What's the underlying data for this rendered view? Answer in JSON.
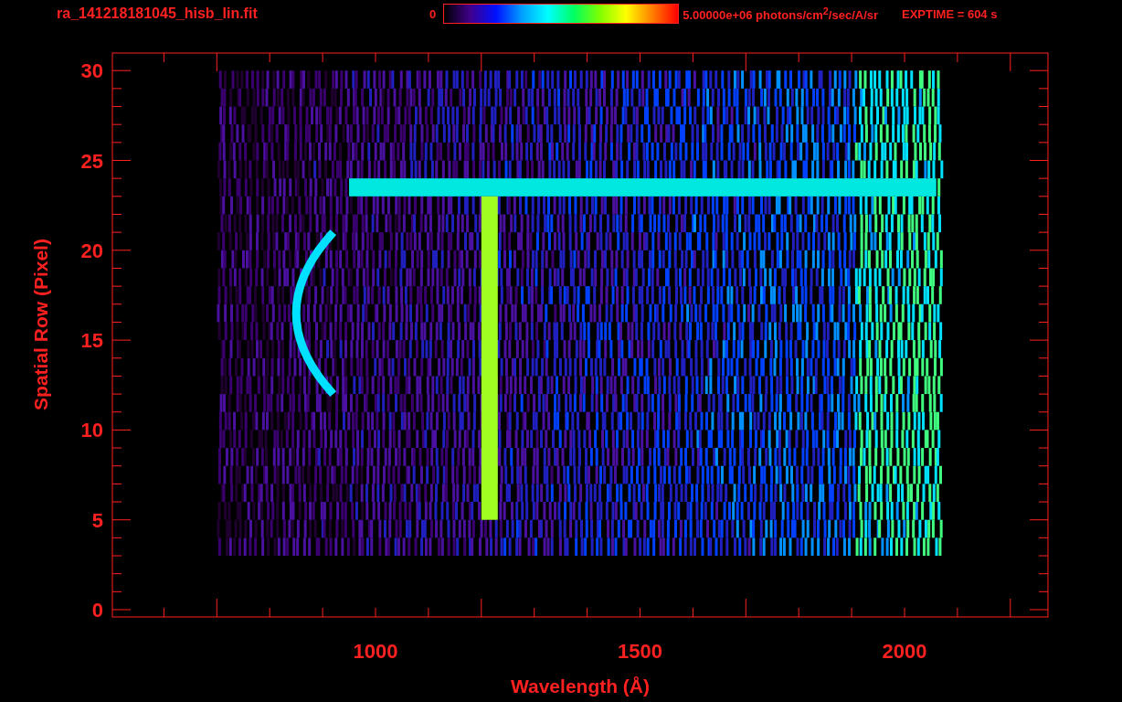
{
  "title": "ra_141218181045_hisb_lin.fit",
  "colorbar": {
    "min_label": "0",
    "max_label": "5.00000e+06 photons/cm$^{2}$/sec/A/sr"
  },
  "exposure": "EXPTIME = 604 s",
  "y_axis": {
    "label": "Spatial Row (Pixel)",
    "ticks": [
      "30",
      "25",
      "20",
      "15",
      "10",
      "5",
      "0"
    ]
  },
  "x_axis": {
    "label": "Wavelength (Å)",
    "ticks": [
      "1000",
      "1500",
      "2000"
    ]
  }
}
